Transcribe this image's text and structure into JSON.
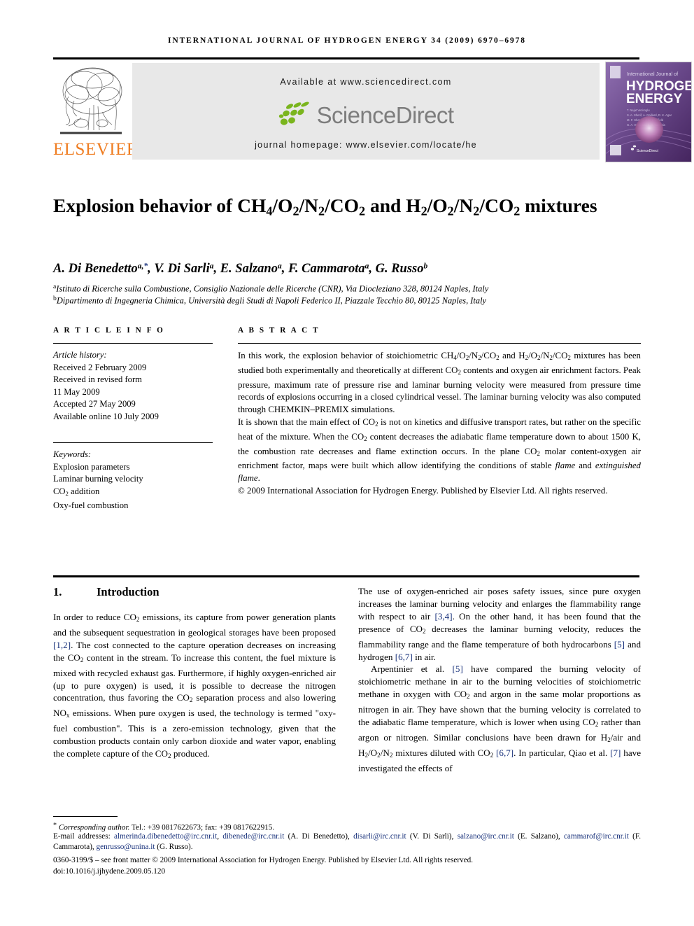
{
  "running_head": "INTERNATIONAL JOURNAL OF HYDROGEN ENERGY 34 (2009) 6970–6978",
  "header": {
    "publisher": "ELSEVIER",
    "available_at": "Available at www.sciencedirect.com",
    "sciencedirect_wordmark": "ScienceDirect",
    "journal_homepage": "journal homepage: www.elsevier.com/locate/he",
    "cover": {
      "kicker": "International Journal of",
      "line1": "HYDROGEN",
      "line2": "ENERGY",
      "footer_mark": "ScienceDirect"
    },
    "colors": {
      "elsevier_orange": "#ef7d22",
      "sciencedirect_gray": "#7d7d7d",
      "sciencedirect_green": "#7ab51d",
      "band_gray": "#e8e8e8",
      "cover_purple": "#6b4a8c",
      "link_navy": "#17307a"
    }
  },
  "article": {
    "title_html": "Explosion behavior of CH<sub>4</sub>/O<sub>2</sub>/N<sub>2</sub>/CO<sub>2</sub> and H<sub>2</sub>/O<sub>2</sub>/N<sub>2</sub>/CO<sub>2</sub> mixtures",
    "title_plain": "Explosion behavior of CH4/O2/N2/CO2 and H2/O2/N2/CO2 mixtures",
    "authors_html": "A. Di Benedetto<sup>a,</sup><sup class=\"star\">*</sup>, V. Di Sarli<sup>a</sup>, E. Salzano<sup>a</sup>, F. Cammarota<sup>a</sup>, G. Russo<sup>b</sup>",
    "authors_plain": "A. Di Benedetto a,*, V. Di Sarli a, E. Salzano a, F. Cammarota a, G. Russo b",
    "affiliation_a_html": "<sup>a</sup>Istituto di Ricerche sulla Combustione, Consiglio Nazionale delle Ricerche (CNR), Via Diocleziano 328, 80124 Naples, Italy",
    "affiliation_b_html": "<sup>b</sup>Dipartimento di Ingegneria Chimica, Università degli Studi di Napoli Federico II, Piazzale Tecchio 80, 80125 Naples, Italy"
  },
  "info": {
    "heading": "A R T I C L E   I N F O",
    "history_label": "Article history:",
    "history": [
      "Received 2 February 2009",
      "Received in revised form",
      "11 May 2009",
      "Accepted 27 May 2009",
      "Available online 10 July 2009"
    ],
    "keywords_label": "Keywords:",
    "keywords_html": [
      "Explosion parameters",
      "Laminar burning velocity",
      "CO<sub>2</sub> addition",
      "Oxy-fuel combustion"
    ],
    "keywords_plain": [
      "Explosion parameters",
      "Laminar burning velocity",
      "CO2 addition",
      "Oxy-fuel combustion"
    ]
  },
  "abstract": {
    "heading": "A B S T R A C T",
    "paragraph_1_html": "In this work, the explosion behavior of stoichiometric CH<sub>4</sub>/O<sub>2</sub>/N<sub>2</sub>/CO<sub>2</sub> and H<sub>2</sub>/O<sub>2</sub>/N<sub>2</sub>/CO<sub>2</sub> mixtures has been studied both experimentally and theoretically at different CO<sub>2</sub> contents and oxygen air enrichment factors. Peak pressure, maximum rate of pressure rise and laminar burning velocity were measured from pressure time records of explosions occurring in a closed cylindrical vessel. The laminar burning velocity was also computed through CHEMKIN–PREMIX simulations.",
    "paragraph_2_html": "It is shown that the main effect of CO<sub>2</sub> is not on kinetics and diffusive transport rates, but rather on the specific heat of the mixture. When the CO<sub>2</sub> content decreases the adiabatic flame temperature down to about 1500 K, the combustion rate decreases and flame extinction occurs. In the plane CO<sub>2</sub> molar content-oxygen air enrichment factor, maps were built which allow identifying the conditions of stable <i>flame</i> and <i>extinguished flame</i>.",
    "copyright_html": "&copy; 2009 International Association for Hydrogen Energy. Published by Elsevier Ltd. All rights reserved."
  },
  "body": {
    "section_number": "1.",
    "section_title": "Introduction",
    "left_paragraph_html": "In order to reduce CO<sub>2</sub> emissions, its capture from power generation plants and the subsequent sequestration in geological storages have been proposed <span class=\"ref\">[1,2]</span>. The cost connected to the capture operation decreases on increasing the CO<sub>2</sub> content in the stream. To increase this content, the fuel mixture is mixed with recycled exhaust gas. Furthermore, if highly oxygen-enriched air (up to pure oxygen) is used, it is possible to decrease the nitrogen concentration, thus favoring the CO<sub>2</sub> separation process and also lowering NO<sub>x</sub> emissions. When pure oxygen is used, the technology is termed &quot;oxy-fuel combustion&quot;. This is a zero-emission technology, given that the combustion products contain only carbon dioxide and water vapor, enabling the complete capture of the CO<sub>2</sub> produced.",
    "right_paragraph_1_html": "The use of oxygen-enriched air poses safety issues, since pure oxygen increases the laminar burning velocity and enlarges the flammability range with respect to air <span class=\"ref\">[3,4]</span>. On the other hand, it has been found that the presence of CO<sub>2</sub> decreases the laminar burning velocity, reduces the flammability range and the flame temperature of both hydrocarbons <span class=\"ref\">[5]</span> and hydrogen <span class=\"ref\">[6,7]</span> in air.",
    "right_paragraph_2_html": "Arpentinier et al. <span class=\"ref\">[5]</span> have compared the burning velocity of stoichiometric methane in air to the burning velocities of stoichiometric methane in oxygen with CO<sub>2</sub> and argon in the same molar proportions as nitrogen in air. They have shown that the burning velocity is correlated to the adiabatic flame temperature, which is lower when using CO<sub>2</sub> rather than argon or nitrogen. Similar conclusions have been drawn for H<sub>2</sub>/air and H<sub>2</sub>/O<sub>2</sub>/N<sub>2</sub> mixtures diluted with CO<sub>2</sub> <span class=\"ref\">[6,7]</span>. In particular, Qiao et al. <span class=\"ref\">[7]</span> have investigated the effects of"
  },
  "footnotes": {
    "corresponding_html": "<sup class=\"star-sup\">*</sup> <i>Corresponding author.</i> Tel.: +39 0817622673; fax: +39 0817622915.",
    "emails_html": "E-mail addresses: <span class=\"mail\">almerinda.dibenedetto@irc.cnr.it</span>, <span class=\"mail\">dibenede@irc.cnr.it</span> (A. Di Benedetto), <span class=\"mail\">disarli@irc.cnr.it</span> (V. Di Sarli), <span class=\"mail\">salzano@irc.cnr.it</span> (E. Salzano), <span class=\"mail\">cammarof@irc.cnr.it</span> (F. Cammarota), <span class=\"mail\">genrusso@unina.it</span> (G. Russo).",
    "issn_line": "0360-3199/$ – see front matter © 2009 International Association for Hydrogen Energy. Published by Elsevier Ltd. All rights reserved.",
    "doi_line": "doi:10.1016/j.ijhydene.2009.05.120"
  }
}
